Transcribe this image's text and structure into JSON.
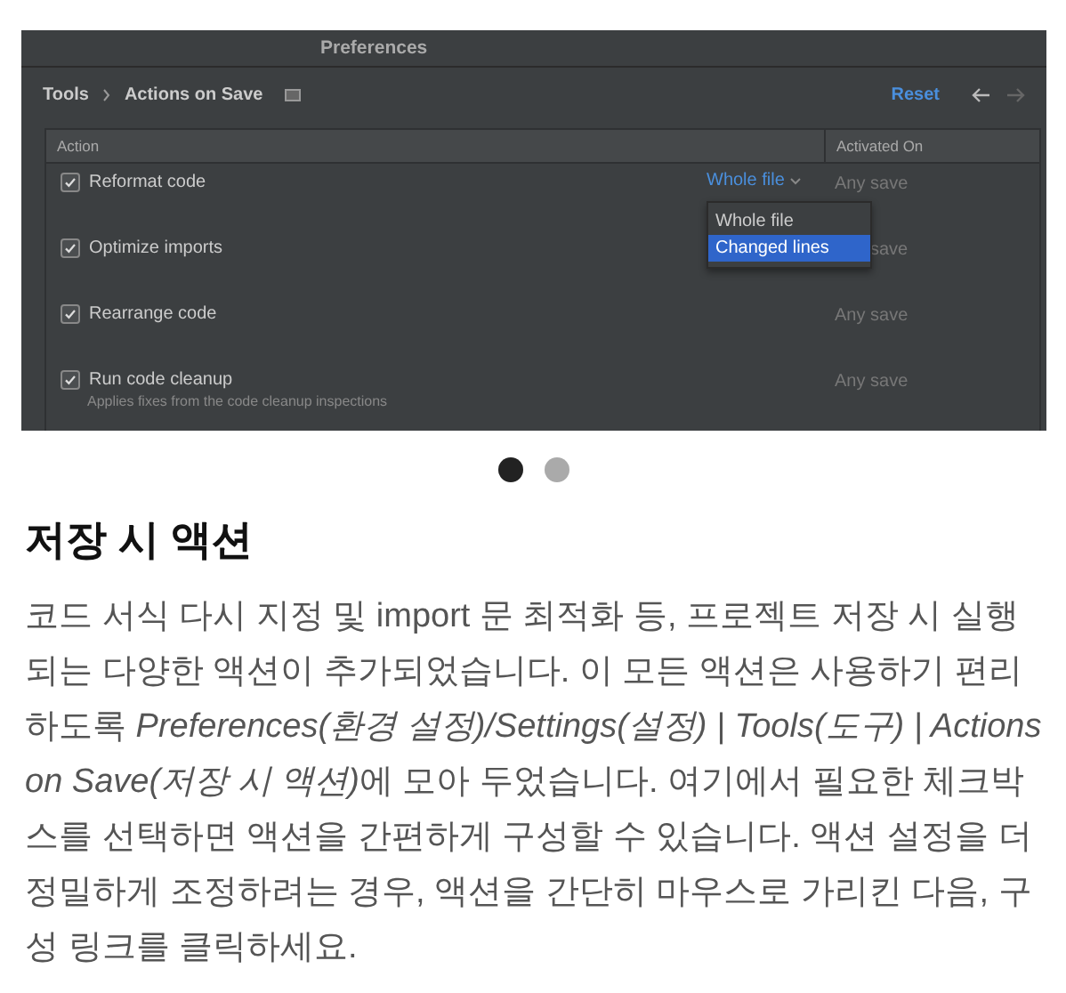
{
  "screenshot": {
    "window_title": "Preferences",
    "breadcrumb": [
      "Tools",
      "Actions on Save"
    ],
    "reset": "Reset",
    "columns": [
      "Action",
      "Activated On"
    ],
    "rows": [
      {
        "label": "Reformat code",
        "checked": true,
        "option": "Whole file",
        "activated_on": "Any save"
      },
      {
        "label": "Optimize imports",
        "checked": true,
        "activated_on": "save"
      },
      {
        "label": "Rearrange code",
        "checked": true,
        "activated_on": "Any save"
      },
      {
        "label": "Run code cleanup",
        "checked": true,
        "description": "Applies fixes from the code cleanup inspections",
        "activated_on": "Any save"
      }
    ],
    "dropdown_menu": [
      {
        "label": "Whole file",
        "selected": false
      },
      {
        "label": "Changed lines",
        "selected": true
      }
    ]
  },
  "carousel_dots": [
    {
      "selected": true
    },
    {
      "selected": false
    }
  ],
  "heading": "저장 시 액션",
  "paragraph": [
    {
      "text": "코드 서식 다시 지정 및 import 문 최적화 등, 프로젝트 저장 시 실행되는 다양한 액션이 추가되었습니다. 이 모든 액션은 사용하기 편리하도록 ",
      "italic": false
    },
    {
      "text": "Preferences(환경 설정)/Settings(설정) | Tools(도구) | Actions on Save(저장 시 액션)",
      "italic": true
    },
    {
      "text": "에 모아 두었습니다. 여기에서 필요한 체크박스를 선택하면 액션을 간편하게 구성할 수 있습니다. 액션 설정을 더 정밀하게 조정하려는 경우, 액션을 간단히 마우스로 가리킨 다음, 구성 링크를 클릭하세요.",
      "italic": false
    }
  ]
}
